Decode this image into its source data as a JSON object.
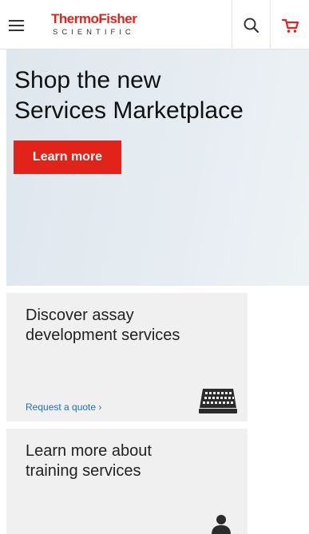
{
  "header": {
    "logo_main": "ThermoFisher",
    "logo_sub": "SCIENTIFIC",
    "menu_icon": "hamburger-menu-icon",
    "search_icon": "search-icon",
    "cart_icon": "cart-icon",
    "accent_color": "#e2231a"
  },
  "hero": {
    "title_line1": "Shop the new",
    "title_line2": "Services Marketplace",
    "button_label": "Learn more"
  },
  "cards": [
    {
      "title_line1": "Discover assay",
      "title_line2": "development services",
      "link_label": "Request a quote ›",
      "icon": "microplate-icon"
    },
    {
      "title_line1": "Learn more about",
      "title_line2": "training services",
      "icon": "person-icon"
    }
  ]
}
